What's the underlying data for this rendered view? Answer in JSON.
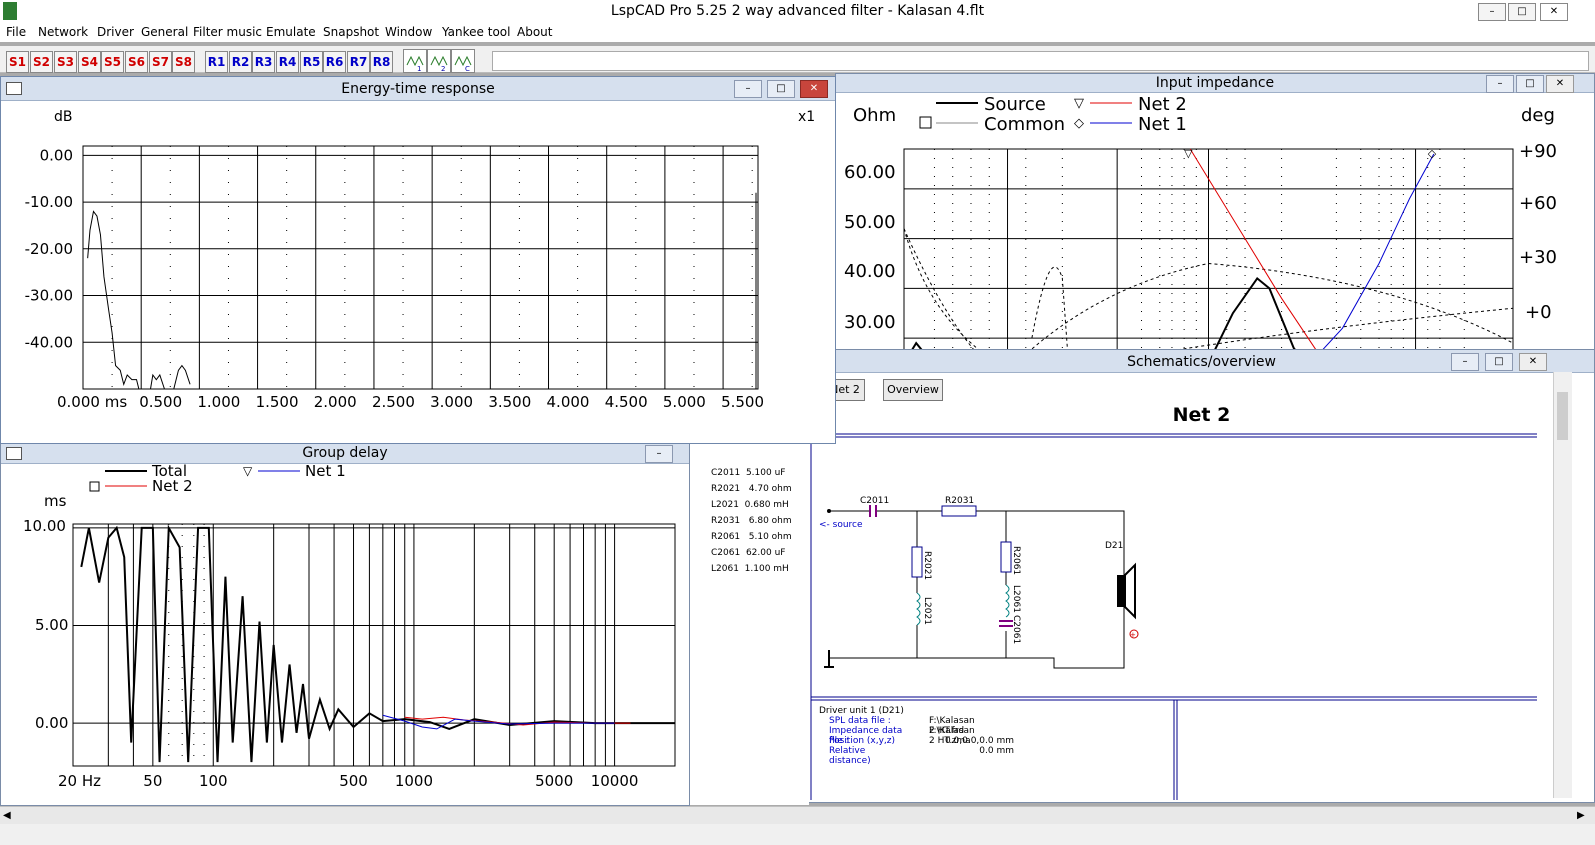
{
  "app": {
    "title": "LspCAD Pro 5.25 2 way advanced filter - Kalasan 4.flt",
    "window_buttons": [
      "–",
      "□",
      "✕"
    ]
  },
  "menu": [
    "File",
    "Network",
    "Driver",
    "General",
    "Filter music",
    "Emulate",
    "Snapshot",
    "Window",
    "Yankee tool",
    "About"
  ],
  "toolbar": {
    "s_buttons": [
      "S1",
      "S2",
      "S3",
      "S4",
      "S5",
      "S6",
      "S7",
      "S8"
    ],
    "r_buttons": [
      "R1",
      "R2",
      "R3",
      "R4",
      "R5",
      "R6",
      "R7",
      "R8"
    ],
    "wave_icons": [
      "wave-1-icon",
      "wave-2-icon",
      "wave-c-icon"
    ],
    "colors": {
      "s": "#d00000",
      "r": "#0000c8"
    }
  },
  "energy_time": {
    "title": "Energy-time response",
    "ylabel": "dB",
    "multiplier": "x1",
    "chart_data": {
      "type": "line",
      "xlabel": "ms",
      "x_ticks": [
        "0.000 ms",
        "0.500",
        "1.000",
        "1.500",
        "2.000",
        "2.500",
        "3.000",
        "3.500",
        "4.000",
        "4.500",
        "5.000",
        "5.500"
      ],
      "y_ticks": [
        "0.00",
        "-10.00",
        "-20.00",
        "-30.00",
        "-40.00"
      ],
      "xlim": [
        0,
        5.8
      ],
      "ylim": [
        -50,
        2
      ],
      "series": [
        {
          "color": "#000000",
          "points": [
            [
              0.04,
              -22
            ],
            [
              0.06,
              -16
            ],
            [
              0.09,
              -12
            ],
            [
              0.12,
              -13
            ],
            [
              0.15,
              -17
            ],
            [
              0.18,
              -26
            ],
            [
              0.22,
              -33
            ],
            [
              0.25,
              -38
            ],
            [
              0.28,
              -45
            ],
            [
              0.32,
              -46
            ],
            [
              0.35,
              -49
            ],
            [
              0.38,
              -47
            ],
            [
              0.42,
              -48
            ],
            [
              0.46,
              -48
            ],
            [
              0.48,
              -50
            ]
          ]
        },
        {
          "color": "#000000",
          "points": [
            [
              0.58,
              -50
            ],
            [
              0.6,
              -47
            ],
            [
              0.63,
              -48
            ],
            [
              0.66,
              -47
            ],
            [
              0.7,
              -50
            ]
          ]
        },
        {
          "color": "#000000",
          "points": [
            [
              0.78,
              -50
            ],
            [
              0.82,
              -46
            ],
            [
              0.85,
              -45
            ],
            [
              0.88,
              -46
            ],
            [
              0.92,
              -49
            ]
          ]
        }
      ]
    }
  },
  "input_impedance": {
    "title": "Input impedance",
    "ylabel_left": "Ohm",
    "ylabel_right": "deg",
    "legend": [
      {
        "label": "Source",
        "marker": "",
        "color": "#000000"
      },
      {
        "label": "Common",
        "marker": "□",
        "color": "#888888"
      },
      {
        "label": "Net 2",
        "marker": "▽",
        "color": "#e00000"
      },
      {
        "label": "Net 1",
        "marker": "◇",
        "color": "#0000d0"
      }
    ],
    "chart_data": {
      "type": "line",
      "y_ticks_left": [
        "60.00",
        "50.00",
        "40.00",
        "30.00"
      ],
      "y_ticks_right": [
        "+90",
        "+60",
        "+30",
        "+0"
      ],
      "ylim": [
        25,
        68
      ],
      "series": [
        {
          "name": "Net 2",
          "color": "#e00000",
          "points": [
            [
              0.47,
              68
            ],
            [
              0.55,
              52
            ],
            [
              0.62,
              38
            ],
            [
              0.68,
              27
            ]
          ]
        },
        {
          "name": "Net 1",
          "color": "#0000d0",
          "points": [
            [
              0.66,
              24
            ],
            [
              0.72,
              32
            ],
            [
              0.78,
              45
            ],
            [
              0.83,
              58
            ],
            [
              0.87,
              67
            ]
          ]
        },
        {
          "name": "Source",
          "color": "#000000",
          "points": [
            [
              0.0,
              25
            ],
            [
              0.02,
              29
            ],
            [
              0.04,
              26
            ],
            [
              0.5,
              25
            ],
            [
              0.54,
              35
            ],
            [
              0.58,
              42
            ],
            [
              0.6,
              40
            ],
            [
              0.64,
              28
            ],
            [
              0.66,
              25
            ]
          ]
        }
      ]
    }
  },
  "schematics": {
    "title": "Schematics/overview",
    "tab_net2": "Net 2",
    "tab_overview": "Overview",
    "heading": "Net 2",
    "parts": [
      {
        "ref": "C2011",
        "value": "5.100 uF"
      },
      {
        "ref": "R2021",
        "value": "4.70 ohm"
      },
      {
        "ref": "L2021",
        "value": "0.680 mH"
      },
      {
        "ref": "R2031",
        "value": "6.80 ohm"
      },
      {
        "ref": "R2061",
        "value": "5.10 ohm"
      },
      {
        "ref": "C2061",
        "value": "62.00 uF"
      },
      {
        "ref": "L2061",
        "value": "1.100 mH"
      }
    ],
    "labels": {
      "c2011": "C2011",
      "r2031": "R2031",
      "r2021": "R2021",
      "l2021": "L2021",
      "r2061": "R2061",
      "l2061": "L2061",
      "c2061": "C2061",
      "d21": "D21",
      "source": "<- source"
    },
    "driver_info": {
      "title": "Driver unit 1 (D21)",
      "rows": [
        {
          "key": "SPL data file :",
          "value": "F:\\Kalasan 2 HT.frd"
        },
        {
          "key": "Impedance data file :",
          "value": "F:\\Kalasan 2 HT.zma"
        },
        {
          "key": "Position (x,y,z)",
          "value": "0.0,0.0,0.0 mm"
        },
        {
          "key": "Relative distance)",
          "value": "0.0 mm"
        }
      ]
    }
  },
  "group_delay": {
    "title": "Group delay",
    "ylabel": "ms",
    "legend": [
      {
        "label": "Total",
        "marker": "",
        "color": "#000000"
      },
      {
        "label": "Net 1",
        "marker": "▽",
        "color": "#0000d0"
      },
      {
        "label": "Net 2",
        "marker": "□",
        "color": "#e00000"
      }
    ],
    "chart_data": {
      "type": "line",
      "x_ticks": [
        "20 Hz",
        "50",
        "100",
        "500",
        "1000",
        "5000",
        "10000"
      ],
      "x_tick_values": [
        20,
        50,
        100,
        500,
        1000,
        5000,
        10000
      ],
      "y_ticks": [
        "10.00",
        "5.00",
        "0.00"
      ],
      "xlim": [
        20,
        20000
      ],
      "ylim": [
        -2.2,
        10.2
      ],
      "series": [
        {
          "name": "Total",
          "color": "#000000",
          "points": [
            [
              22,
              8.0
            ],
            [
              24,
              10
            ],
            [
              27,
              7.2
            ],
            [
              30,
              9.5
            ],
            [
              33,
              10
            ],
            [
              36,
              8.5
            ],
            [
              39,
              -1
            ],
            [
              44,
              10
            ],
            [
              50,
              10
            ],
            [
              54,
              -2
            ],
            [
              60,
              10
            ],
            [
              68,
              9
            ],
            [
              75,
              -2
            ],
            [
              84,
              10
            ],
            [
              95,
              10
            ],
            [
              105,
              -2
            ],
            [
              115,
              7.5
            ],
            [
              125,
              -1
            ],
            [
              140,
              6.5
            ],
            [
              155,
              -2
            ],
            [
              170,
              5.2
            ],
            [
              185,
              -1
            ],
            [
              200,
              4.0
            ],
            [
              220,
              -1
            ],
            [
              240,
              3.0
            ],
            [
              260,
              -0.5
            ],
            [
              280,
              2.0
            ],
            [
              300,
              -0.8
            ],
            [
              340,
              1.2
            ],
            [
              380,
              -0.3
            ],
            [
              420,
              0.7
            ],
            [
              500,
              -0.2
            ],
            [
              600,
              0.5
            ],
            [
              700,
              0.1
            ],
            [
              900,
              0.2
            ],
            [
              1200,
              0.05
            ],
            [
              1500,
              -0.3
            ],
            [
              2000,
              0.2
            ],
            [
              3000,
              -0.1
            ],
            [
              5000,
              0.1
            ],
            [
              8000,
              0
            ],
            [
              12000,
              0
            ],
            [
              20000,
              0
            ]
          ]
        },
        {
          "name": "Net 2",
          "color": "#e00000",
          "points": [
            [
              900,
              0.3
            ],
            [
              1100,
              0.2
            ],
            [
              1400,
              0.3
            ],
            [
              1800,
              0.15
            ],
            [
              2500,
              0.05
            ],
            [
              3500,
              -0.1
            ],
            [
              5000,
              0.05
            ],
            [
              8000,
              0
            ],
            [
              12000,
              0
            ]
          ]
        },
        {
          "name": "Net 1",
          "color": "#0000d0",
          "points": [
            [
              700,
              0.4
            ],
            [
              900,
              0.1
            ],
            [
              1100,
              -0.2
            ],
            [
              1300,
              -0.3
            ],
            [
              1600,
              0.2
            ],
            [
              2000,
              0.1
            ],
            [
              3000,
              -0.05
            ],
            [
              5000,
              0
            ],
            [
              10000,
              0
            ]
          ]
        }
      ]
    }
  }
}
